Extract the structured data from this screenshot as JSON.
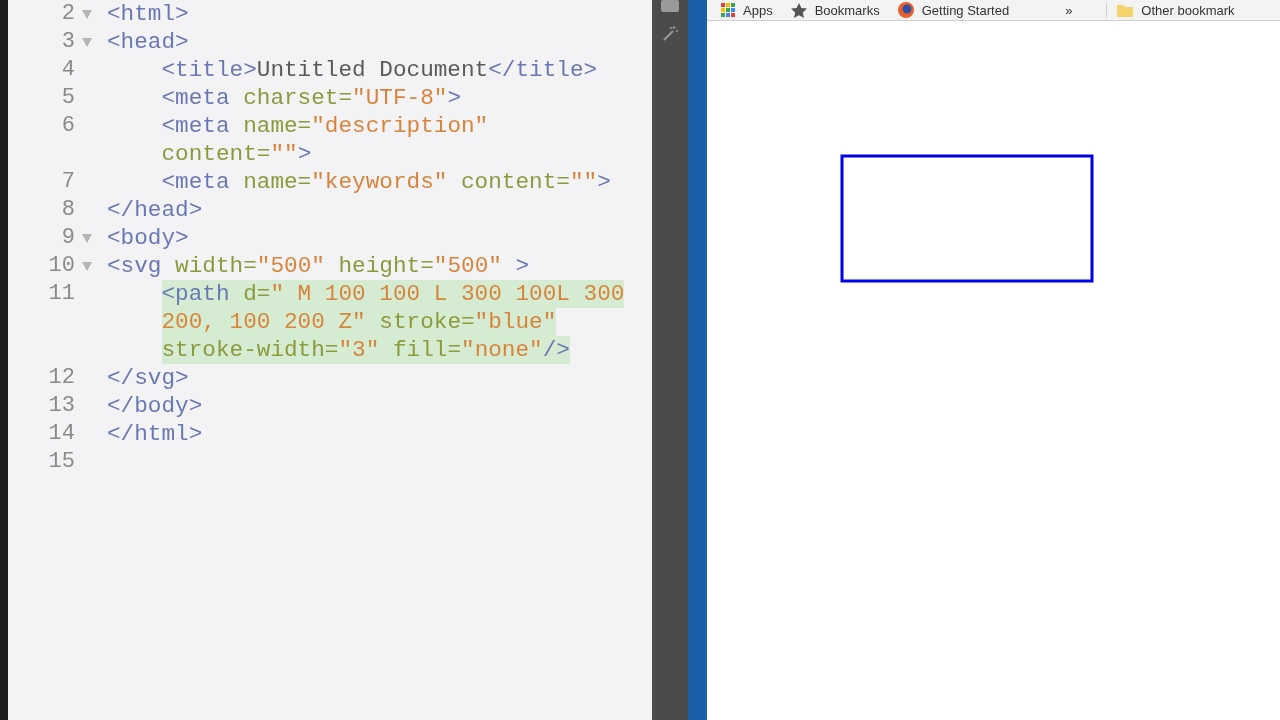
{
  "editor": {
    "lines": [
      {
        "number": "2",
        "foldable": true,
        "highlighted": false,
        "rows": [
          {
            "tokens": [
              {
                "kind": "tag",
                "text": "<html>"
              }
            ]
          }
        ]
      },
      {
        "number": "3",
        "foldable": true,
        "highlighted": false,
        "rows": [
          {
            "tokens": [
              {
                "kind": "tag",
                "text": "<head>"
              }
            ]
          }
        ]
      },
      {
        "number": "4",
        "foldable": false,
        "highlighted": false,
        "rows": [
          {
            "tokens": [
              {
                "kind": "tag",
                "text": "    <title>"
              },
              {
                "kind": "text",
                "text": "Untitled Document"
              },
              {
                "kind": "tag",
                "text": "</title>"
              }
            ]
          }
        ]
      },
      {
        "number": "5",
        "foldable": false,
        "highlighted": false,
        "rows": [
          {
            "tokens": [
              {
                "kind": "tag",
                "text": "    <meta "
              },
              {
                "kind": "attr",
                "text": "charset="
              },
              {
                "kind": "value",
                "text": "\"UTF-8\""
              },
              {
                "kind": "tag",
                "text": ">"
              }
            ]
          }
        ]
      },
      {
        "number": "6",
        "foldable": false,
        "highlighted": false,
        "rows": [
          {
            "tokens": [
              {
                "kind": "tag",
                "text": "    <meta "
              },
              {
                "kind": "attr",
                "text": "name="
              },
              {
                "kind": "value",
                "text": "\"description\""
              }
            ]
          },
          {
            "tokens": [
              {
                "kind": "attr",
                "text": "    content="
              },
              {
                "kind": "value",
                "text": "\"\""
              },
              {
                "kind": "tag",
                "text": ">"
              }
            ]
          }
        ]
      },
      {
        "number": "7",
        "foldable": false,
        "highlighted": false,
        "rows": [
          {
            "tokens": [
              {
                "kind": "tag",
                "text": "    <meta "
              },
              {
                "kind": "attr",
                "text": "name="
              },
              {
                "kind": "value",
                "text": "\"keywords\""
              },
              {
                "kind": "attr",
                "text": " content="
              },
              {
                "kind": "value",
                "text": "\"\""
              },
              {
                "kind": "tag",
                "text": ">"
              }
            ]
          }
        ]
      },
      {
        "number": "8",
        "foldable": false,
        "highlighted": false,
        "rows": [
          {
            "tokens": [
              {
                "kind": "tag",
                "text": "</head>"
              }
            ]
          }
        ]
      },
      {
        "number": "9",
        "foldable": true,
        "highlighted": false,
        "rows": [
          {
            "tokens": [
              {
                "kind": "tag",
                "text": "<body>"
              }
            ]
          }
        ]
      },
      {
        "number": "10",
        "foldable": true,
        "highlighted": false,
        "rows": [
          {
            "tokens": [
              {
                "kind": "tag",
                "text": "<svg "
              },
              {
                "kind": "attr",
                "text": "width="
              },
              {
                "kind": "value",
                "text": "\"500\""
              },
              {
                "kind": "attr",
                "text": " height="
              },
              {
                "kind": "value",
                "text": "\"500\""
              },
              {
                "kind": "tag",
                "text": " >"
              }
            ]
          }
        ]
      },
      {
        "number": "11",
        "foldable": false,
        "highlighted": true,
        "rows": [
          {
            "tokens": [
              {
                "kind": "tag",
                "text": "    <path "
              },
              {
                "kind": "attr",
                "text": "d="
              },
              {
                "kind": "value",
                "text": "\" M 100 100 L 300 100L 300"
              }
            ]
          },
          {
            "tokens": [
              {
                "kind": "value",
                "text": "    200, 100 200 Z\""
              },
              {
                "kind": "attr",
                "text": " stroke="
              },
              {
                "kind": "value",
                "text": "\"blue\""
              }
            ]
          },
          {
            "tokens": [
              {
                "kind": "attr",
                "text": "    stroke-width="
              },
              {
                "kind": "value",
                "text": "\"3\""
              },
              {
                "kind": "attr",
                "text": " fill="
              },
              {
                "kind": "value",
                "text": "\"none\""
              },
              {
                "kind": "tag",
                "text": "/>"
              }
            ]
          }
        ]
      },
      {
        "number": "12",
        "foldable": false,
        "highlighted": false,
        "rows": [
          {
            "tokens": [
              {
                "kind": "tag",
                "text": "</svg>"
              }
            ]
          }
        ]
      },
      {
        "number": "13",
        "foldable": false,
        "highlighted": false,
        "rows": [
          {
            "tokens": [
              {
                "kind": "tag",
                "text": "</body>"
              }
            ]
          }
        ]
      },
      {
        "number": "14",
        "foldable": false,
        "highlighted": false,
        "rows": [
          {
            "tokens": [
              {
                "kind": "tag",
                "text": "</html>"
              }
            ]
          }
        ]
      },
      {
        "number": "15",
        "foldable": false,
        "highlighted": false
      }
    ]
  },
  "browser": {
    "bookmarks": [
      {
        "kind": "apps",
        "label": "Apps"
      },
      {
        "kind": "star",
        "label": "Bookmarks"
      },
      {
        "kind": "globe",
        "label": "Getting Started"
      },
      {
        "kind": "more",
        "label": "»"
      },
      {
        "kind": "folder",
        "label": "Other bookmark"
      }
    ]
  }
}
